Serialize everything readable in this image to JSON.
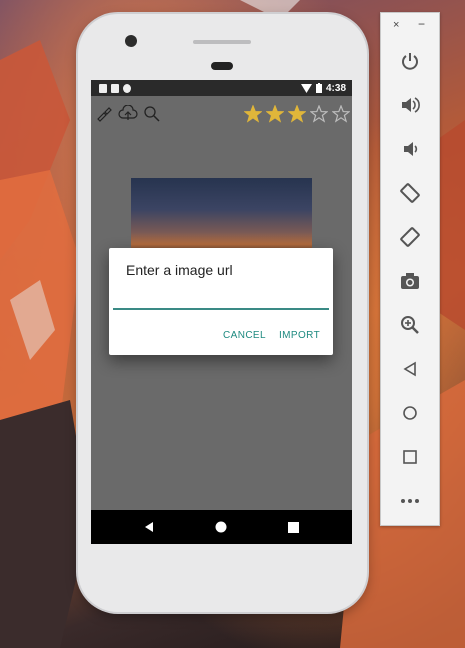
{
  "status_bar": {
    "time": "4:38",
    "left_icons": [
      "notification-a-icon",
      "sd-card-icon",
      "circle-notification-icon"
    ],
    "right_icons": [
      "wifi-icon",
      "battery-icon"
    ]
  },
  "toolbar": {
    "icons": [
      "paint-brush-icon",
      "cloud-upload-icon",
      "search-icon"
    ],
    "rating": {
      "filled": 3,
      "total": 5,
      "filled_color": "#e0b63a",
      "empty_color": "#bdbdbd"
    }
  },
  "dialog": {
    "title": "Enter a image url",
    "input_value": "",
    "cancel_label": "CANCEL",
    "import_label": "IMPORT",
    "accent_color": "#1e8a80"
  },
  "nav": {
    "buttons": [
      "back-icon",
      "home-icon",
      "recents-icon"
    ]
  },
  "emulator_panel": {
    "close_label": "×",
    "minimize_label": "−",
    "buttons": [
      "power-icon",
      "volume-up-icon",
      "volume-down-icon",
      "rotate-left-icon",
      "rotate-right-icon",
      "camera-icon",
      "zoom-icon",
      "back-icon",
      "home-icon",
      "overview-icon",
      "more-icon"
    ]
  }
}
